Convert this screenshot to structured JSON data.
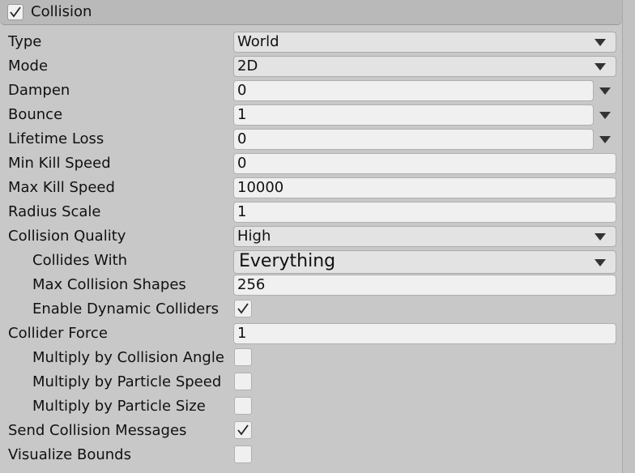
{
  "header": {
    "title": "Collision",
    "enabled": true
  },
  "rows": [
    {
      "label": "Type",
      "value": "World"
    },
    {
      "label": "Mode",
      "value": "2D"
    },
    {
      "label": "Dampen",
      "value": "0"
    },
    {
      "label": "Bounce",
      "value": "1"
    },
    {
      "label": "Lifetime Loss",
      "value": "0"
    },
    {
      "label": "Min Kill Speed",
      "value": "0"
    },
    {
      "label": "Max Kill Speed",
      "value": "10000"
    },
    {
      "label": "Radius Scale",
      "value": "1"
    },
    {
      "label": "Collision Quality",
      "value": "High"
    },
    {
      "label": "Collides With",
      "value": "Everything"
    },
    {
      "label": "Max Collision Shapes",
      "value": "256"
    },
    {
      "label": "Enable Dynamic Colliders",
      "checked": true
    },
    {
      "label": "Collider Force",
      "value": "1"
    },
    {
      "label": "Multiply by Collision Angle",
      "checked": false
    },
    {
      "label": "Multiply by Particle Speed",
      "checked": false
    },
    {
      "label": "Multiply by Particle Size",
      "checked": false
    },
    {
      "label": "Send Collision Messages",
      "checked": true
    },
    {
      "label": "Visualize Bounds",
      "checked": false
    }
  ],
  "icons": {
    "dropdown_arrow": "triangle-down-icon",
    "checkmark": "checkmark-icon"
  }
}
